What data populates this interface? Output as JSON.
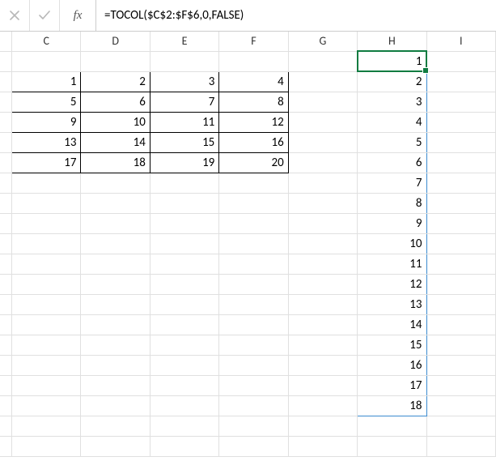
{
  "formula_bar": {
    "cancel_tip": "Cancel",
    "enter_tip": "Enter",
    "fx_label": "fx",
    "formula": "=TOCOL($C$2:$F$6,0,FALSE)"
  },
  "columns": [
    "C",
    "D",
    "E",
    "F",
    "G",
    "H",
    "I"
  ],
  "active_column": "H",
  "source_block": {
    "rows": [
      [
        1,
        2,
        3,
        4
      ],
      [
        5,
        6,
        7,
        8
      ],
      [
        9,
        10,
        11,
        12
      ],
      [
        13,
        14,
        15,
        16
      ],
      [
        17,
        18,
        19,
        20
      ]
    ]
  },
  "spill_column": {
    "values": [
      1,
      2,
      3,
      4,
      5,
      6,
      7,
      8,
      9,
      10,
      11,
      12,
      13,
      14,
      15,
      16,
      17,
      18
    ]
  },
  "chart_data": {
    "type": "table",
    "title": "TOCOL result of C2:F6",
    "input_range": "C2:F6",
    "input_values": [
      [
        1,
        2,
        3,
        4
      ],
      [
        5,
        6,
        7,
        8
      ],
      [
        9,
        10,
        11,
        12
      ],
      [
        13,
        14,
        15,
        16
      ],
      [
        17,
        18,
        19,
        20
      ]
    ],
    "output_range_start": "H1",
    "output_values": [
      1,
      2,
      3,
      4,
      5,
      6,
      7,
      8,
      9,
      10,
      11,
      12,
      13,
      14,
      15,
      16,
      17,
      18
    ]
  }
}
